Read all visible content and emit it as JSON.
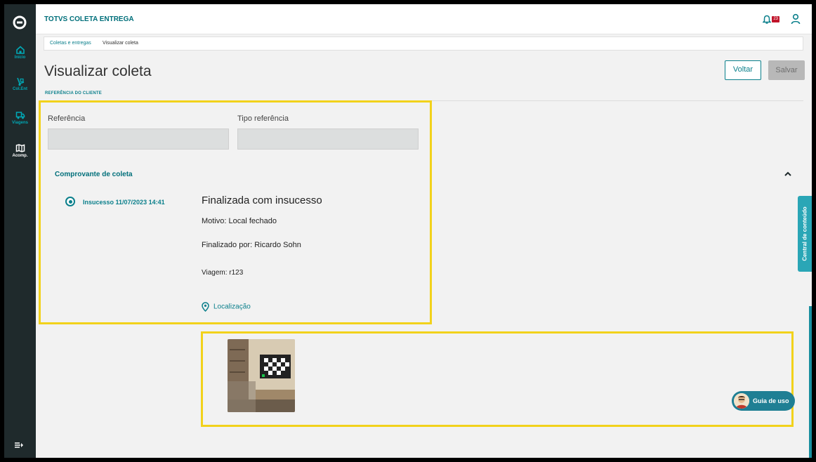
{
  "app": {
    "title": "TOTVS COLETA ENTREGA",
    "notification_count": "23"
  },
  "sidebar": {
    "items": [
      {
        "label": "Início",
        "icon": "home-icon"
      },
      {
        "label": "Col.Ent",
        "icon": "dolly-icon"
      },
      {
        "label": "Viagens",
        "icon": "truck-icon"
      },
      {
        "label": "Acomp.",
        "icon": "map-icon"
      }
    ]
  },
  "breadcrumb": {
    "parent": "Coletas e entregas",
    "current": "Visualizar coleta"
  },
  "page": {
    "title": "Visualizar coleta",
    "back_label": "Voltar",
    "save_label": "Salvar"
  },
  "section": {
    "client_reference_label": "REFERÊNCIA DO CLIENTE"
  },
  "form": {
    "reference_label": "Referência",
    "reference_value": "",
    "reference_type_label": "Tipo referência",
    "reference_type_value": ""
  },
  "proof": {
    "title": "Comprovante de coleta",
    "event_label": "Insucesso 11/07/2023 14:41",
    "status": "Finalizada com insucesso",
    "reason": "Motivo: Local fechado",
    "finished_by": "Finalizado por: Ricardo Sohn",
    "trip": "Viagem: r123",
    "location_link": "Localização"
  },
  "side_tab": {
    "label": "Central de conteúdo"
  },
  "help": {
    "label": "Guia de uso"
  },
  "colors": {
    "accent": "#0a7f8b",
    "sidebar": "#1f2a2c",
    "highlight": "#f2d21b",
    "badge": "#c0142a"
  }
}
